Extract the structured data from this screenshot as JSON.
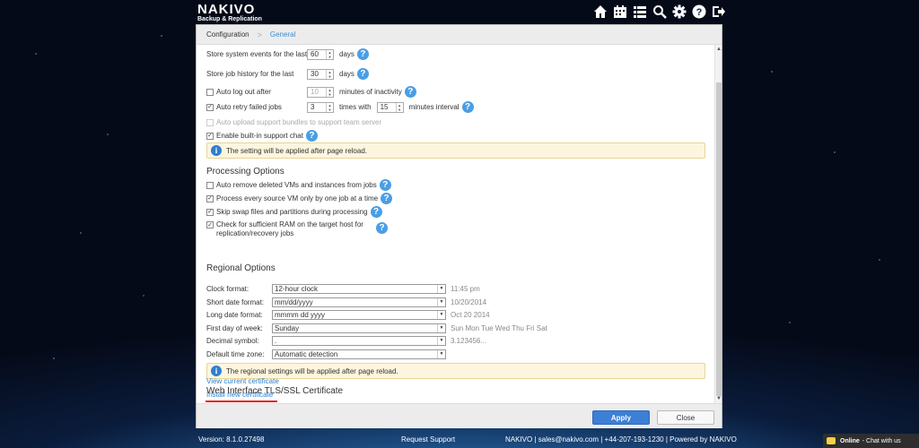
{
  "header": {
    "brand_line1": "NAKIVO",
    "brand_line2": "Backup & Replication"
  },
  "breadcrumb": {
    "parent": "Configuration",
    "current": "General"
  },
  "general": {
    "store_events_label": "Store system events for the last",
    "store_events_value": "60",
    "store_events_unit": "days",
    "store_history_label": "Store job history for the last",
    "store_history_value": "30",
    "store_history_unit": "days",
    "auto_logout_label": "Auto log out after",
    "auto_logout_value": "10",
    "auto_logout_unit": "minutes of inactivity",
    "auto_logout_checked": false,
    "auto_retry_label": "Auto retry failed jobs",
    "auto_retry_times": "3",
    "auto_retry_times_label": "times with",
    "auto_retry_interval": "15",
    "auto_retry_interval_label": "minutes interval",
    "auto_retry_checked": true,
    "auto_upload_label": "Auto upload support bundles to support team server",
    "support_chat_label": "Enable built-in support chat",
    "support_chat_checked": true,
    "notice": "The setting will be applied after page reload."
  },
  "processing": {
    "title": "Processing Options",
    "items": [
      {
        "label": "Auto remove deleted VMs and instances from jobs",
        "checked": false
      },
      {
        "label": "Process every source VM only by one job at a time",
        "checked": true
      },
      {
        "label": "Skip swap files and partitions during processing",
        "checked": true
      },
      {
        "label": "Check for sufficient RAM on the target host for",
        "label2": "replication/recovery jobs",
        "checked": true
      }
    ]
  },
  "regional": {
    "title": "Regional Options",
    "rows": [
      {
        "label": "Clock format:",
        "value": "12-hour clock",
        "example": "11:45 pm"
      },
      {
        "label": "Short date format:",
        "value": "mm/dd/yyyy",
        "example": "10/20/2014"
      },
      {
        "label": "Long date format:",
        "value": "mmmm dd yyyy",
        "example": "Oct 20 2014"
      },
      {
        "label": "First day of week:",
        "value": "Sunday",
        "example": "Sun Mon Tue Wed Thu Fri Sat"
      },
      {
        "label": "Decimal symbol:",
        "value": ".",
        "example": "3.123456..."
      },
      {
        "label": "Default time zone:",
        "value": "Automatic detection",
        "example": ""
      }
    ],
    "notice": "The regional settings will be applied after page reload."
  },
  "certificate": {
    "title": "Web Interface TLS/SSL Certificate",
    "view_link": "View current certificate",
    "install_link": "Install new certificate"
  },
  "buttons": {
    "apply": "Apply",
    "close": "Close"
  },
  "footer": {
    "version": "Version: 8.1.0.27498",
    "request_support": "Request Support",
    "contact": "NAKIVO | sales@nakivo.com | +44-207-193-1230 | Powered by NAKIVO"
  },
  "chat": {
    "status": "Online",
    "label": "- Chat with us"
  },
  "colors": {
    "accent": "#3c7fd7",
    "link": "#2a7fcf",
    "notice_bg": "#fdf5dd",
    "highlight": "#e21a1a"
  }
}
